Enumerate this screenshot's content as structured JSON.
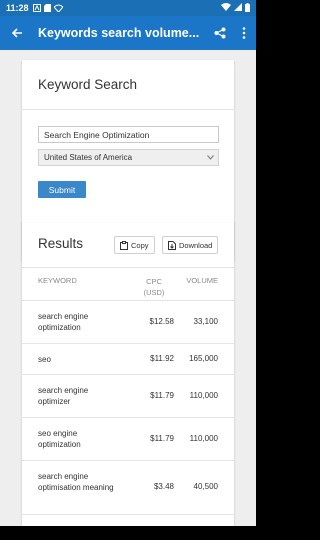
{
  "status_bar": {
    "time": "11:28"
  },
  "app_bar": {
    "title": "Keywords search volume..."
  },
  "search_card": {
    "title": "Keyword Search",
    "keyword_value": "Search Engine Optimization",
    "country_value": "United States of America",
    "submit_label": "Submit"
  },
  "results_card": {
    "title": "Results",
    "copy_label": "Copy",
    "download_label": "Download",
    "headers": {
      "keyword": "KEYWORD",
      "cpc": "CPC\n(USD)",
      "cpc_line1": "CPC",
      "cpc_line2": "(USD)",
      "volume": "VOLUME"
    },
    "rows": [
      {
        "keyword": "search engine optimization",
        "cpc": "$12.58",
        "volume": "33,100"
      },
      {
        "keyword": "seo",
        "cpc": "$11.92",
        "volume": "165,000"
      },
      {
        "keyword": "search engine optimizer",
        "cpc": "$11.79",
        "volume": "110,000"
      },
      {
        "keyword": "seo engine optimization",
        "cpc": "$11.79",
        "volume": "110,000"
      },
      {
        "keyword": "search engine optimisation meaning",
        "cpc": "$3.48",
        "volume": "40,500"
      }
    ]
  },
  "colors": {
    "app_bar": "#1b76c7",
    "status_bar": "#1a6fb5",
    "submit": "#3a87c9"
  }
}
